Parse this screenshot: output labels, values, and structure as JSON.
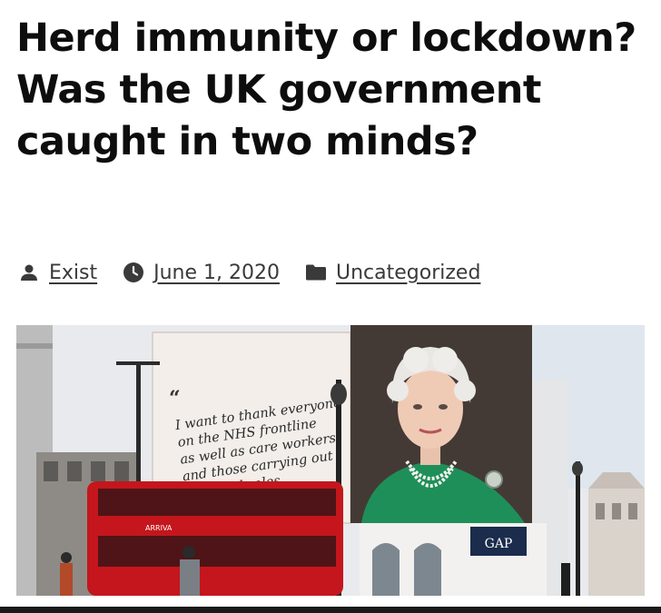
{
  "article": {
    "title": "Herd immunity or lockdown? Was the UK government caught in two minds?",
    "meta": {
      "author": "Exist",
      "author_icon": "person-icon",
      "date": "June 1, 2020",
      "date_icon": "clock-icon",
      "category": "Uncategorized",
      "category_icon": "folder-icon"
    }
  },
  "photo": {
    "billboard_quote": {
      "open_mark": "“",
      "lines": [
        "I want to thank everyone",
        "on the NHS frontline",
        "as well as care workers",
        "and those carrying out",
        "essential roles"
      ],
      "close_mark": "”"
    },
    "storefront_sign": "GAP",
    "bus_sign": "ARRIVA"
  },
  "colors": {
    "text": "#0d0d0d",
    "meta_text": "#3a3a3a",
    "bus_red": "#c4161c",
    "queen_green": "#1f8f5a",
    "sky": "#e6e8ec"
  }
}
